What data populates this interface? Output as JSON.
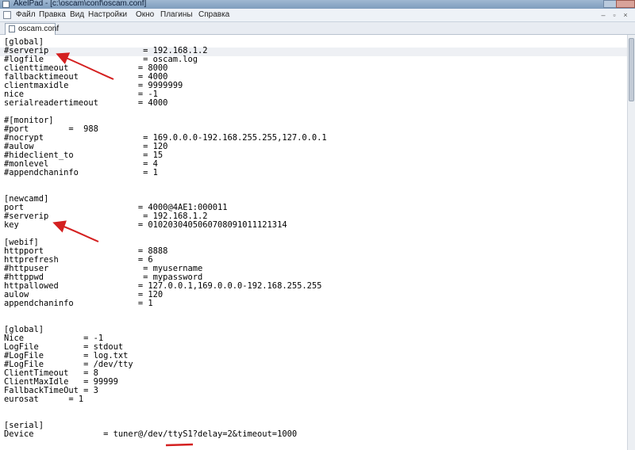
{
  "window": {
    "title": "AkelPad - [c:\\oscam\\conf\\oscam.conf]"
  },
  "menu": [
    "Файл",
    "Правка",
    "Вид",
    "Настройки",
    "Окно",
    "Плагины",
    "Справка"
  ],
  "tab": {
    "label": "oscam.conf"
  },
  "editor": {
    "lines": [
      "[global]",
      "#serverip                   = 192.168.1.2",
      "#logfile                    = oscam.log",
      "clienttimeout              = 8000",
      "fallbacktimeout            = 4000",
      "clientmaxidle              = 9999999",
      "nice                       = -1",
      "serialreadertimeout        = 4000",
      "",
      "#[monitor]",
      "#port        =  988",
      "#nocrypt                    = 169.0.0.0-192.168.255.255,127.0.0.1",
      "#aulow                      = 120",
      "#hideclient_to              = 15",
      "#monlevel                   = 4",
      "#appendchaninfo             = 1",
      "",
      "",
      "[newcamd]",
      "port                       = 4000@4AE1:000011",
      "#serverip                   = 192.168.1.2",
      "key                        = 0102030405060708091011121314",
      "",
      "[webif]",
      "httpport                   = 8888",
      "httprefresh                = 6",
      "#httpuser                   = myusername",
      "#httppwd                    = mypassword",
      "httpallowed                = 127.0.0.1,169.0.0.0-192.168.255.255",
      "aulow                      = 120",
      "appendchaninfo             = 1",
      "",
      "",
      "[global]",
      "Nice            = -1",
      "LogFile         = stdout",
      "#LogFile        = log.txt",
      "#LogFile        = /dev/tty",
      "ClientTimeout   = 8",
      "ClientMaxIdle   = 99999",
      "FallbackTimeOut = 3",
      "eurosat      = 1",
      "",
      "",
      "[serial]",
      "Device              = tuner@/dev/ttyS1?delay=2&timeout=1000"
    ]
  },
  "colors": {
    "annotation": "#d42020",
    "current_line": "#eef0f4"
  },
  "icons": {
    "app": "document-icon",
    "tab": "document-icon",
    "annotations": "red-arrow"
  }
}
